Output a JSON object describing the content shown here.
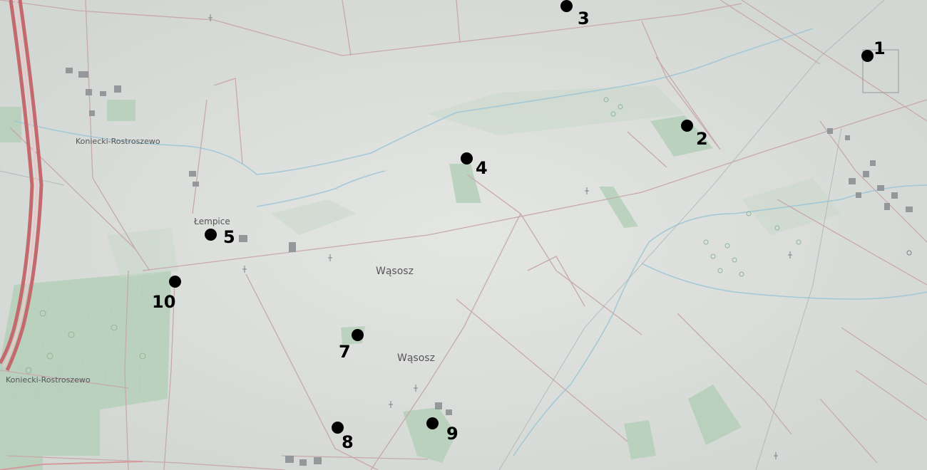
{
  "place_names": {
    "koniecki_top": "Koniecki-Rostroszewo",
    "koniecki_bottom": "Koniecki-Rostroszewo",
    "lempice": "Łempice",
    "wasosz_center": "Wąsosz",
    "wasosz_south": "Wąsosz"
  },
  "markers": [
    {
      "id": "m1",
      "label": "1"
    },
    {
      "id": "m2",
      "label": "2"
    },
    {
      "id": "m3",
      "label": "3"
    },
    {
      "id": "m4",
      "label": "4"
    },
    {
      "id": "m5",
      "label": "5"
    },
    {
      "id": "m7",
      "label": "7"
    },
    {
      "id": "m8",
      "label": "8"
    },
    {
      "id": "m9",
      "label": "9"
    },
    {
      "id": "m10",
      "label": "10"
    }
  ],
  "colors": {
    "terrain": "#dcdfdc",
    "forest": "#a9c8b0",
    "field_line": "#c4a3a6",
    "water": "#9fc7d6",
    "highway": "#c46a6e",
    "marker": "#000000"
  }
}
